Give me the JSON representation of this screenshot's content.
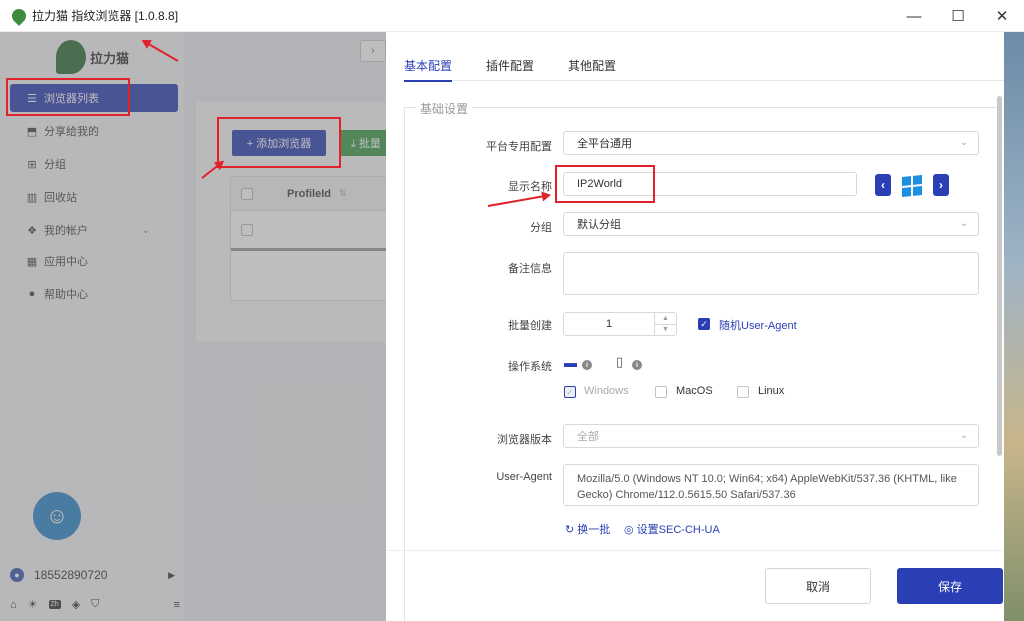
{
  "window": {
    "title": "拉力猫 指纹浏览器  [1.0.8.8]",
    "minimize": "—",
    "maximize": "☐",
    "close": "✕"
  },
  "background_app": {
    "brand": "拉力猫",
    "collapse_tab": "›",
    "sidebar": {
      "items": [
        {
          "icon": "list-icon",
          "label": "浏览器列表"
        },
        {
          "icon": "share-icon",
          "label": "分享给我的"
        },
        {
          "icon": "group-icon",
          "label": "分组"
        },
        {
          "icon": "trash-icon",
          "label": "回收站"
        },
        {
          "icon": "account-icon",
          "label": "我的帐户"
        },
        {
          "icon": "apps-icon",
          "label": "应用中心"
        },
        {
          "icon": "help-icon",
          "label": "帮助中心"
        }
      ]
    },
    "phone": "18552890720",
    "bottom": {
      "zh": "Zh"
    },
    "buttons": {
      "add": "+ 添加浏览器",
      "batch": "⤓  批量"
    },
    "table": {
      "header": "ProfileId"
    }
  },
  "drawer": {
    "tabs": [
      "基本配置",
      "插件配置",
      "其他配置"
    ],
    "section_title": "基础设置",
    "fields": {
      "platform": {
        "label": "平台专用配置",
        "value": "全平台通用"
      },
      "display_name": {
        "label": "显示名称",
        "value": "IP2World"
      },
      "group": {
        "label": "分组",
        "value": "默认分组"
      },
      "notes": {
        "label": "备注信息",
        "value": ""
      },
      "batch": {
        "label": "批量创建",
        "value": "1",
        "random_ua_label": "随机User-Agent"
      },
      "os": {
        "label": "操作系统",
        "options": [
          "Windows",
          "MacOS",
          "Linux"
        ]
      },
      "browser_version": {
        "label": "浏览器版本",
        "placeholder": "全部"
      },
      "user_agent": {
        "label": "User-Agent",
        "value_line1": "Mozilla/5.0 (Windows NT 10.0; Win64; x64) AppleWebKit/537.36 (KHTML, like",
        "value_line2": "Gecko) Chrome/112.0.5615.50 Safari/537.36"
      }
    },
    "links": {
      "refresh": "换一批",
      "sec_ch_ua": "设置SEC-CH-UA"
    },
    "footer": {
      "cancel": "取消",
      "save": "保存"
    }
  },
  "colors": {
    "primary": "#2b3fb4",
    "annotation": "#e0222a",
    "green": "#3c9a4a",
    "windows": "#1d8fe0"
  }
}
